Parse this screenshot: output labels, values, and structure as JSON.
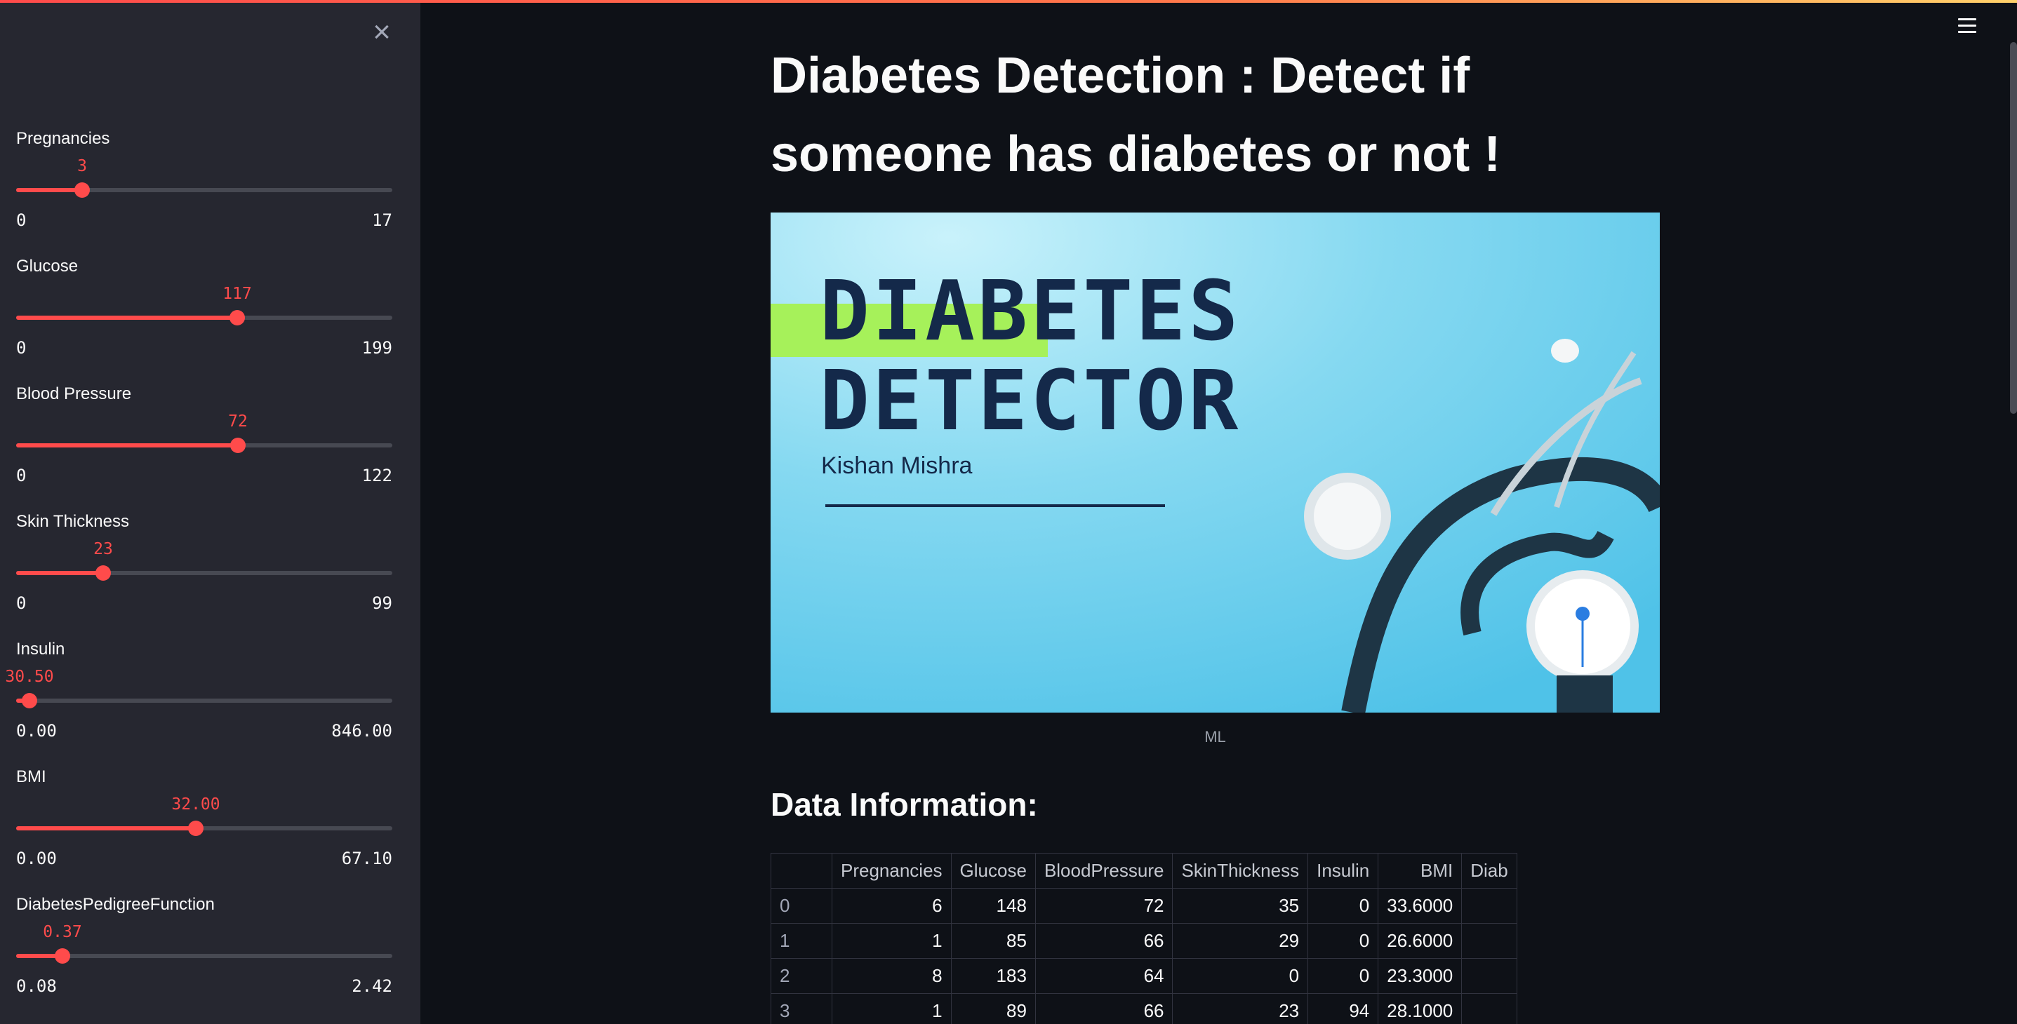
{
  "sidebar": {
    "sliders": [
      {
        "label": "Pregnancies",
        "value": "3",
        "min": "0",
        "max": "17",
        "fraction": 0.176
      },
      {
        "label": "Glucose",
        "value": "117",
        "min": "0",
        "max": "199",
        "fraction": 0.588
      },
      {
        "label": "Blood Pressure",
        "value": "72",
        "min": "0",
        "max": "122",
        "fraction": 0.59
      },
      {
        "label": "Skin Thickness",
        "value": "23",
        "min": "0",
        "max": "99",
        "fraction": 0.232
      },
      {
        "label": "Insulin",
        "value": "30.50",
        "min": "0.00",
        "max": "846.00",
        "fraction": 0.036
      },
      {
        "label": "BMI",
        "value": "32.00",
        "min": "0.00",
        "max": "67.10",
        "fraction": 0.477
      },
      {
        "label": "DiabetesPedigreeFunction",
        "value": "0.37",
        "min": "0.08",
        "max": "2.42",
        "fraction": 0.124
      }
    ]
  },
  "main": {
    "title": "Diabetes Detection : Detect if someone has diabetes or not !",
    "hero": {
      "line1": "DIABETES",
      "line2": "DETECTOR",
      "author": "Kishan Mishra",
      "caption": "ML"
    },
    "section_title": "Data Information:",
    "table": {
      "columns": [
        "Pregnancies",
        "Glucose",
        "BloodPressure",
        "SkinThickness",
        "Insulin",
        "BMI",
        "Diab"
      ],
      "rows": [
        {
          "index": "0",
          "cells": [
            "6",
            "148",
            "72",
            "35",
            "0",
            "33.6000",
            ""
          ]
        },
        {
          "index": "1",
          "cells": [
            "1",
            "85",
            "66",
            "29",
            "0",
            "26.6000",
            ""
          ]
        },
        {
          "index": "2",
          "cells": [
            "8",
            "183",
            "64",
            "0",
            "0",
            "23.3000",
            ""
          ]
        },
        {
          "index": "3",
          "cells": [
            "1",
            "89",
            "66",
            "23",
            "94",
            "28.1000",
            ""
          ]
        }
      ]
    }
  },
  "colors": {
    "accent": "#ff4b4b",
    "sidebar_bg": "#262730",
    "main_bg": "#0e1117",
    "hero_text": "#14294a",
    "hero_highlight": "#a6f15a"
  },
  "icons": {
    "close": "close-icon",
    "menu": "hamburger-menu-icon"
  }
}
